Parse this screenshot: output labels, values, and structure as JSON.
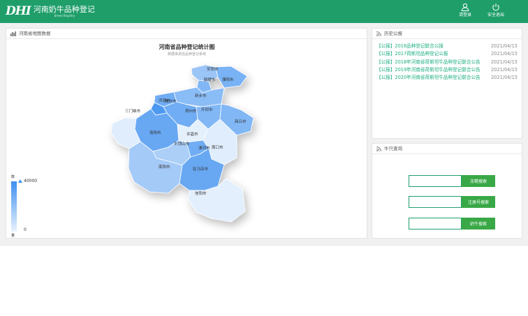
{
  "header": {
    "logo_mark": "DHI",
    "logo_title": "河南奶牛品种登记",
    "logo_subtitle": "Breed Registry",
    "login_label": "请登录",
    "logout_label": "安全退出",
    "user_icon": "user-icon",
    "power_icon": "power-icon"
  },
  "map_panel": {
    "header": "河南省地图数据",
    "title": "河南省品种登记统计图",
    "subtitle": "数据来源自品种登记系统",
    "legend_max": "40000",
    "legend_min": "0",
    "legend_high_label": "数",
    "legend_low_label": "量",
    "colors": {
      "high": "#3d8ff0",
      "low": "#e8f2fd"
    },
    "cities": [
      {
        "name": "安阳市",
        "level": 0.45
      },
      {
        "name": "鹤壁市",
        "level": 0.6
      },
      {
        "name": "濮阳市",
        "level": 0.65
      },
      {
        "name": "焦作市",
        "level": 0.7
      },
      {
        "name": "新乡市",
        "level": 0.55
      },
      {
        "name": "济源市",
        "level": 0.9
      },
      {
        "name": "洛阳市",
        "level": 0.75
      },
      {
        "name": "郑州市",
        "level": 0.7
      },
      {
        "name": "开封市",
        "level": 0.6
      },
      {
        "name": "商丘市",
        "level": 0.6
      },
      {
        "name": "三门峡市",
        "level": 0.05
      },
      {
        "name": "许昌市",
        "level": 0.02
      },
      {
        "name": "平顶山市",
        "level": 0.35
      },
      {
        "name": "漯河市",
        "level": 0.7
      },
      {
        "name": "周口市",
        "level": 0.05
      },
      {
        "name": "南阳市",
        "level": 0.4
      },
      {
        "name": "驻马店市",
        "level": 0.75
      },
      {
        "name": "信阳市",
        "level": 0.03
      }
    ]
  },
  "notices": {
    "header": "历史公报",
    "items": [
      {
        "title": "【公报】2016品种登记联合公报",
        "date": "2021/04/15"
      },
      {
        "title": "【公报】2017荷斯坦品种登记公报",
        "date": "2021/04/15"
      },
      {
        "title": "【公报】2018年河南省荷斯坦牛品种登记联合公告",
        "date": "2021/04/15"
      },
      {
        "title": "【公报】2019年河南省荷斯坦牛品种登记联合公告",
        "date": "2021/04/15"
      },
      {
        "title": "【公报】2020年河南省荷斯坦牛品种登记联合公告",
        "date": "2021/04/15"
      }
    ]
  },
  "cattle_search": {
    "header": "牛只查询",
    "rows": [
      {
        "input_value": "",
        "button": "冻精搜索"
      },
      {
        "input_value": "",
        "button": "注册号搜索"
      },
      {
        "input_value": "",
        "button": "奶牛搜索"
      }
    ]
  }
}
